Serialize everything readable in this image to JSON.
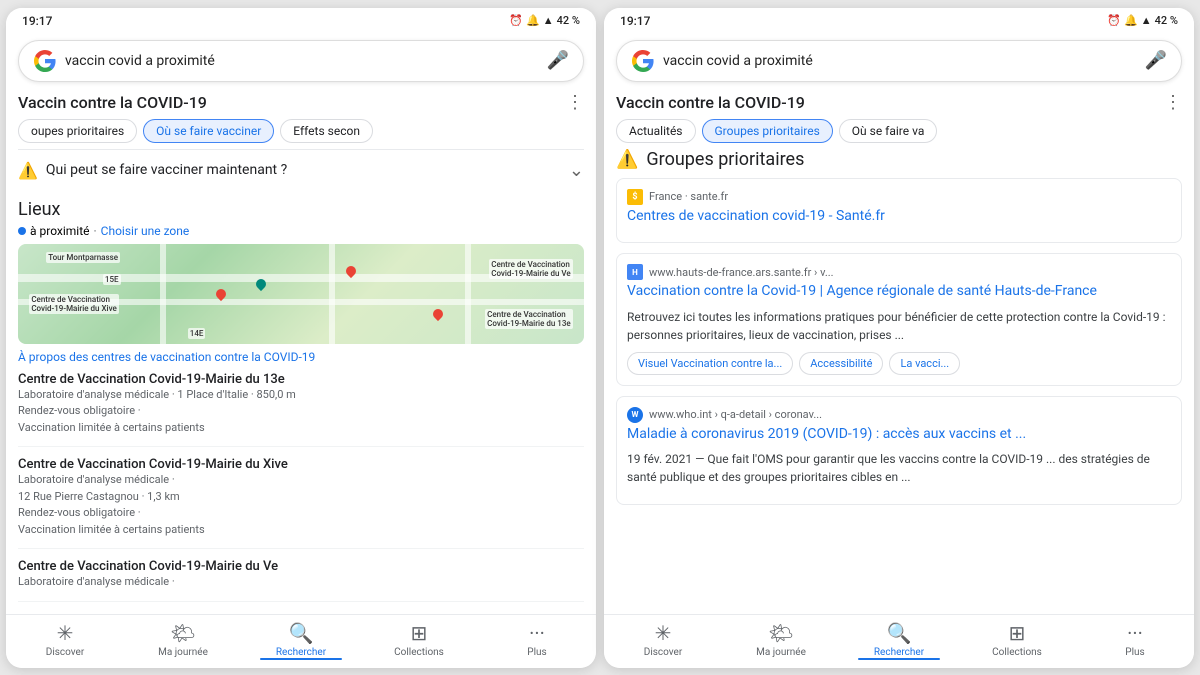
{
  "left_phone": {
    "status_time": "19:17",
    "status_battery": "42 %",
    "search_query": "vaccin covid a proximité",
    "topic_title": "Vaccin contre la COVID-19",
    "chips": [
      {
        "label": "oupes prioritaires",
        "active": false
      },
      {
        "label": "Où se faire vacciner",
        "active": true
      },
      {
        "label": "Effets secon",
        "active": false
      }
    ],
    "accordion_text": "Qui peut se faire vacciner maintenant ?",
    "section_lieux": "Lieux",
    "location_near": "à proximité",
    "location_choose": "Choisir une zone",
    "map_link": "À propos des centres de vaccination contre la COVID-19",
    "centers": [
      {
        "name": "Centre de Vaccination Covid-19-Mairie du 13e",
        "detail1": "Laboratoire d'analyse médicale · 1 Place d'Italie · 850,0 m",
        "detail2": "Rendez-vous obligatoire ·",
        "detail3": "Vaccination limitée à certains patients"
      },
      {
        "name": "Centre de Vaccination Covid-19-Mairie du Xive",
        "detail1": "Laboratoire d'analyse médicale ·",
        "detail2": "12 Rue Pierre Castagnou · 1,3 km",
        "detail3": "Rendez-vous obligatoire ·",
        "detail4": "Vaccination limitée à certains patients"
      },
      {
        "name": "Centre de Vaccination Covid-19-Mairie du Ve",
        "detail1": "Laboratoire d'analyse médicale ·"
      }
    ],
    "nav": [
      {
        "icon": "✳",
        "label": "Discover",
        "active": false
      },
      {
        "icon": "☀",
        "label": "Ma journée",
        "active": false
      },
      {
        "icon": "🔍",
        "label": "Rechercher",
        "active": true
      },
      {
        "icon": "⊡",
        "label": "Collections",
        "active": false
      },
      {
        "icon": "•••",
        "label": "Plus",
        "active": false
      }
    ]
  },
  "right_phone": {
    "status_time": "19:17",
    "status_battery": "42 %",
    "search_query": "vaccin covid a proximité",
    "topic_title": "Vaccin contre la COVID-19",
    "chips": [
      {
        "label": "Actualités",
        "active": false
      },
      {
        "label": "Groupes prioritaires",
        "active": true
      },
      {
        "label": "Où se faire va",
        "active": false
      }
    ],
    "priority_title": "Groupes prioritaires",
    "source1": {
      "icon_text": "$",
      "source_text": "France · sante.fr",
      "link": "Centres de vaccination covid-19 - Santé.fr"
    },
    "result1": {
      "source_url": "www.hauts-de-france.ars.sante.fr › v...",
      "title": "Vaccination contre la Covid-19 | Agence régionale de santé Hauts-de-France",
      "desc": "Retrouvez ici toutes les informations pratiques pour bénéficier de cette protection contre la Covid-19 : personnes prioritaires, lieux de vaccination, prises ...",
      "sitelinks": [
        "Visuel Vaccination contre la...",
        "Accessibilité",
        "La vacci..."
      ]
    },
    "result2": {
      "source_url": "www.who.int › q-a-detail › coronav...",
      "title": "Maladie à coronavirus 2019 (COVID-19) : accès aux vaccins et ...",
      "desc": "19 fév. 2021 — Que fait l'OMS pour garantir que les vaccins contre la COVID-19 ... des stratégies de santé publique et des groupes prioritaires cibles en ..."
    },
    "nav": [
      {
        "icon": "✳",
        "label": "Discover",
        "active": false
      },
      {
        "icon": "☀",
        "label": "Ma journée",
        "active": false
      },
      {
        "icon": "🔍",
        "label": "Rechercher",
        "active": true
      },
      {
        "icon": "⊡",
        "label": "Collections",
        "active": false
      },
      {
        "icon": "•••",
        "label": "Plus",
        "active": false
      }
    ]
  }
}
